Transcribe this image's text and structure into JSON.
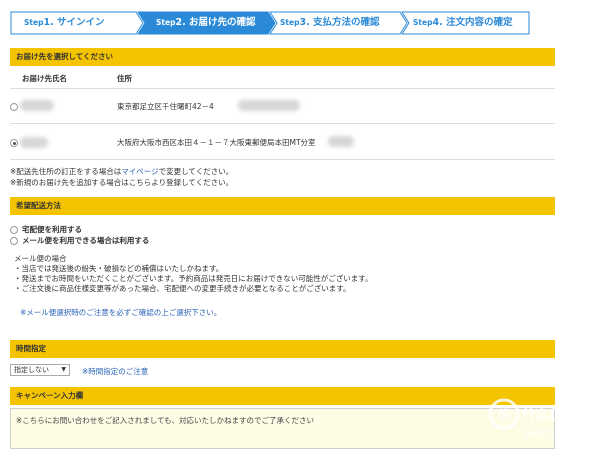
{
  "steps": [
    {
      "prefix": "Step",
      "num": "1.",
      "label": "サインイン"
    },
    {
      "prefix": "Step",
      "num": "2.",
      "label": "お届け先の確認"
    },
    {
      "prefix": "Step",
      "num": "3.",
      "label": "支払方法の確認"
    },
    {
      "prefix": "Step",
      "num": "4.",
      "label": "注文内容の確定"
    }
  ],
  "address": {
    "section_title": "お届け先を選択してください",
    "col_name": "お届け先氏名",
    "col_address": "住所",
    "rows": [
      {
        "address": "東京都足立区千住曙町42－4",
        "selected": false
      },
      {
        "address": "大阪府大阪市西区本田４－１－７大阪東郵便局本田MT分室",
        "selected": true
      }
    ],
    "note1_prefix": "※配送先住所の訂正をする場合は",
    "note1_link": "マイページ",
    "note1_suffix": "で変更してください。",
    "note2": "※新規のお届け先を追加する場合はこちらより登録してください。"
  },
  "delivery": {
    "section_title": "希望配送方法",
    "options": [
      {
        "label": "宅配便を利用する",
        "selected": false
      },
      {
        "label": "メール便を利用できる場合は利用する",
        "selected": false
      }
    ],
    "mail_title": "メール便の場合",
    "mail_notes": [
      "・当店では発送後の紛失・破損などの補償はいたしかねます。",
      "・発送までお時間をいただくことがございます。予約商品は発売日にお届けできない可能性がございます。",
      "・ご注文後に商品住様変更等があった場合、宅配便への変更手続きが必要となることがございます。"
    ],
    "warning": "※メール便選択時のご注意を必ずご確認の上ご選択下さい。"
  },
  "time": {
    "section_title": "時間指定",
    "select_value": "指定しない",
    "note": "※時間指定のご注意"
  },
  "campaign": {
    "section_title": "キャンペーン入力欄",
    "placeholder": "※こちらにお問い合わせをご記入されましても、対応いたしかねますのでご了承ください"
  },
  "watermark": {
    "text": "什么值得买",
    "domain": "SMZDM.COM",
    "logo_char": "值"
  },
  "colors": {
    "accent": "#2b8ad8",
    "bar": "#f5c400",
    "link": "#2a63b8"
  }
}
